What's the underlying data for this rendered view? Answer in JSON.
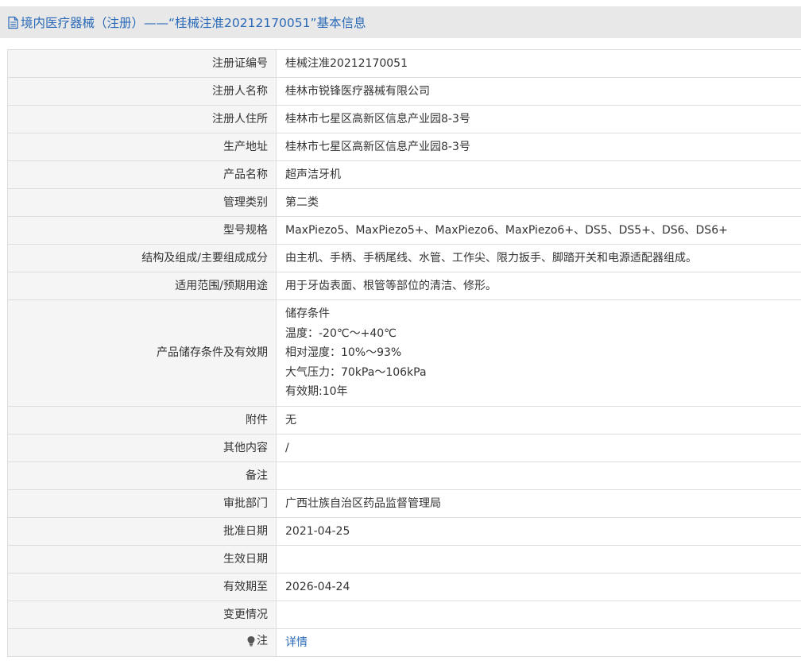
{
  "header": {
    "title": "境内医疗器械（注册）——“桂械注准20212170051”基本信息",
    "icon": "document-icon",
    "color": "#2a6ab8"
  },
  "rows": [
    {
      "label": "注册证编号",
      "value": "桂械注准20212170051"
    },
    {
      "label": "注册人名称",
      "value": "桂林市锐锋医疗器械有限公司"
    },
    {
      "label": "注册人住所",
      "value": "桂林市七星区高新区信息产业园8-3号"
    },
    {
      "label": "生产地址",
      "value": "桂林市七星区高新区信息产业园8-3号"
    },
    {
      "label": "产品名称",
      "value": "超声洁牙机"
    },
    {
      "label": "管理类别",
      "value": "第二类"
    },
    {
      "label": "型号规格",
      "value": "MaxPiezo5、MaxPiezo5+、MaxPiezo6、MaxPiezo6+、DS5、DS5+、DS6、DS6+"
    },
    {
      "label": "结构及组成/主要组成成分",
      "value": "由主机、手柄、手柄尾线、水管、工作尖、限力扳手、脚踏开关和电源适配器组成。"
    },
    {
      "label": "适用范围/预期用途",
      "value": "用于牙齿表面、根管等部位的清洁、修形。"
    }
  ],
  "storage": {
    "label": "产品储存条件及有效期",
    "lines": [
      "储存条件",
      "温度：-20℃～+40℃",
      "相对湿度：10%～93%",
      "大气压力：70kPa～106kPa",
      "有效期:10年"
    ]
  },
  "rows2": [
    {
      "label": "附件",
      "value": "无"
    },
    {
      "label": "其他内容",
      "value": "/"
    },
    {
      "label": "备注",
      "value": ""
    },
    {
      "label": "审批部门",
      "value": "广西壮族自治区药品监督管理局"
    },
    {
      "label": "批准日期",
      "value": "2021-04-25"
    },
    {
      "label": "生效日期",
      "value": ""
    },
    {
      "label": "有效期至",
      "value": "2026-04-24"
    },
    {
      "label": "变更情况",
      "value": ""
    }
  ],
  "note": {
    "label": "注",
    "icon": "lightbulb-icon",
    "link": "详情"
  }
}
